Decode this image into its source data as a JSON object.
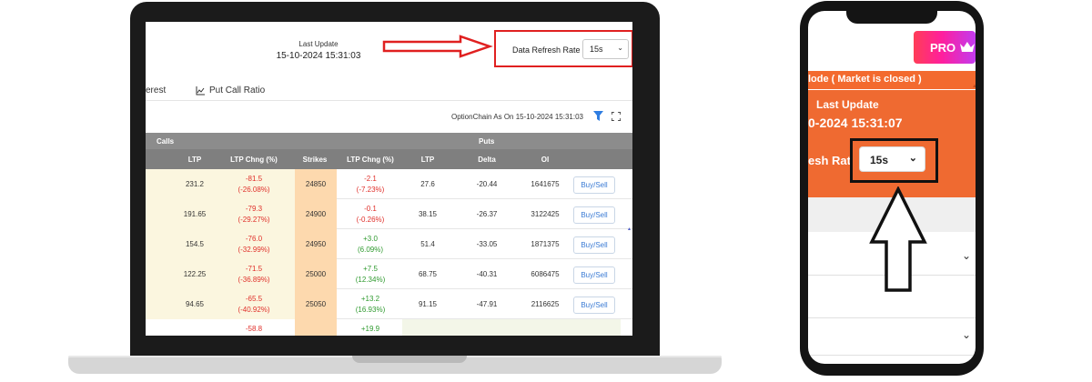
{
  "laptop": {
    "last_update_label": "Last Update",
    "last_update_value": "15-10-2024 15:31:03",
    "refresh_label": "Data Refresh Rate",
    "refresh_value": "15s",
    "tabs": [
      "erest",
      "Put Call Ratio"
    ],
    "optionchain_asof": "OptionChain As On 15-10-2024 15:31:03",
    "group_headers": {
      "calls": "Calls",
      "puts": "Puts"
    },
    "columns": [
      "LTP",
      "LTP Chng (%)",
      "Strikes",
      "LTP Chng (%)",
      "LTP",
      "Delta",
      "OI"
    ],
    "rows": [
      {
        "call_ltp": "231.2",
        "call_chg": "-81.5",
        "call_pct": "(-26.08%)",
        "strike": "24850",
        "put_chg": "-2.1",
        "put_pct": "(-7.23%)",
        "put_ltp": "27.6",
        "delta": "-20.44",
        "oi": "1641675",
        "btn": "Buy/Sell"
      },
      {
        "call_ltp": "191.65",
        "call_chg": "-79.3",
        "call_pct": "(-29.27%)",
        "strike": "24900",
        "put_chg": "-0.1",
        "put_pct": "(-0.26%)",
        "put_ltp": "38.15",
        "delta": "-26.37",
        "oi": "3122425",
        "btn": "Buy/Sell"
      },
      {
        "call_ltp": "154.5",
        "call_chg": "-76.0",
        "call_pct": "(-32.99%)",
        "strike": "24950",
        "put_chg": "+3.0",
        "put_pct": "(6.09%)",
        "put_ltp": "51.4",
        "delta": "-33.05",
        "oi": "1871375",
        "btn": "Buy/Sell"
      },
      {
        "call_ltp": "122.25",
        "call_chg": "-71.5",
        "call_pct": "(-36.89%)",
        "strike": "25000",
        "put_chg": "+7.5",
        "put_pct": "(12.34%)",
        "put_ltp": "68.75",
        "delta": "-40.31",
        "oi": "6086475",
        "btn": "Buy/Sell"
      },
      {
        "call_ltp": "94.65",
        "call_chg": "-65.5",
        "call_pct": "(-40.92%)",
        "strike": "25050",
        "put_chg": "+13.2",
        "put_pct": "(16.93%)",
        "put_ltp": "91.15",
        "delta": "-47.91",
        "oi": "2116625",
        "btn": "Buy/Sell"
      },
      {
        "call_ltp": "",
        "call_chg": "-58.8",
        "call_pct": "",
        "strike": "",
        "put_chg": "+19.9",
        "put_pct": "",
        "put_ltp": "",
        "delta": "",
        "oi": "",
        "btn": ""
      }
    ]
  },
  "phone": {
    "pro_label": "PRO",
    "mode_text": "lode ( Market is closed )",
    "last_update_label": "Last Update",
    "last_update_value": "0-2024 15:31:07",
    "refresh_label": "esh Rat",
    "refresh_value": "15s"
  },
  "colors": {
    "highlight_red": "#e02020",
    "orange": "#ef6a31",
    "pro_gradient_start": "#ff3d57",
    "pro_gradient_end": "#c23bf0",
    "negative": "#e0302b",
    "positive": "#2f9a2f"
  }
}
